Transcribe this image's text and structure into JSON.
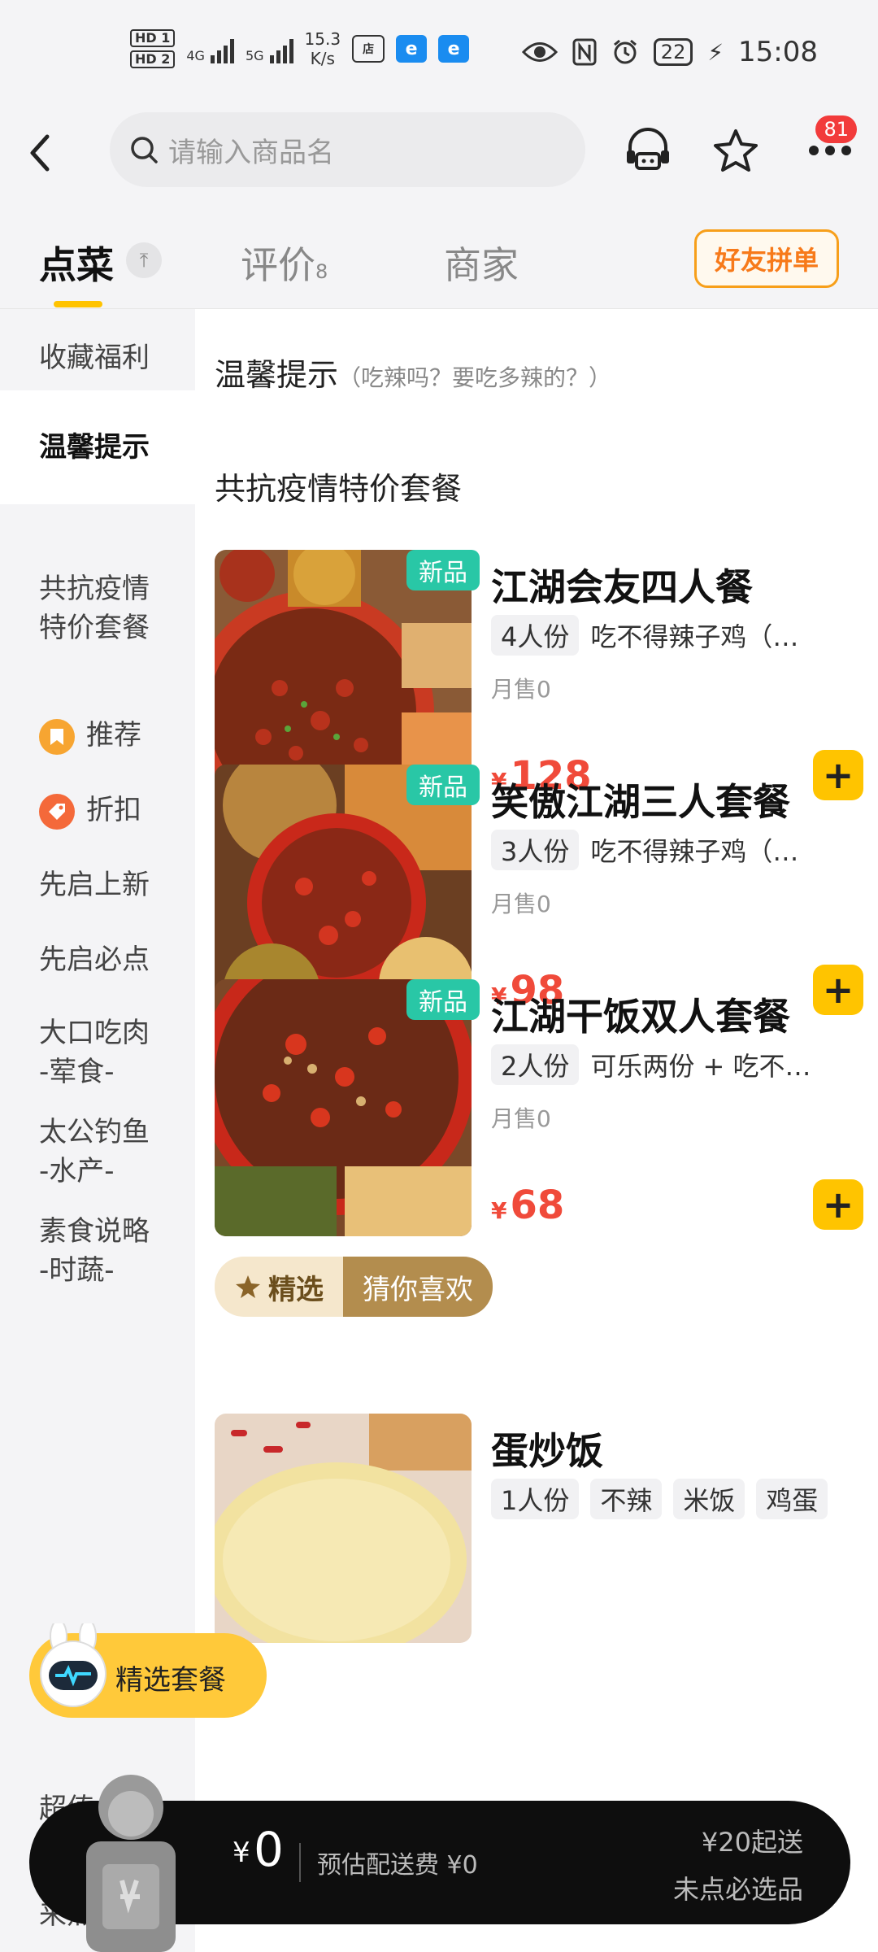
{
  "status_bar": {
    "hd1": "HD 1",
    "hd2": "HD 2",
    "net_4g": "4G",
    "net_5g": "5G",
    "speed_value": "15.3",
    "speed_unit": "K/s",
    "battery": "22",
    "time": "15:08"
  },
  "header": {
    "search_placeholder": "请输入商品名",
    "notification_count": "81"
  },
  "tabs": [
    {
      "label": "点菜"
    },
    {
      "label": "评价",
      "count": "8"
    },
    {
      "label": "商家"
    }
  ],
  "friend_order_label": "好友拼单",
  "sidebar": {
    "items": [
      {
        "label": "收藏福利"
      },
      {
        "label": "温馨提示"
      },
      {
        "label": "共抗疫情\n特价套餐"
      },
      {
        "label": "推荐"
      },
      {
        "label": "折扣"
      },
      {
        "label": "先启上新"
      },
      {
        "label": "先启必点"
      },
      {
        "label": "大口吃肉\n-荤食-"
      },
      {
        "label": "太公钓鱼\n-水产-"
      },
      {
        "label": "素食说略\n-时蔬-"
      },
      {
        "label": "超值"
      },
      {
        "label": "来点主食"
      }
    ]
  },
  "content": {
    "tip_title": "温馨提示",
    "tip_sub": "（吃辣吗？要吃多辣的？）",
    "section_title": "共抗疫情特价套餐",
    "new_tag": "新品",
    "items": [
      {
        "name": "江湖会友四人餐",
        "portion": "4人份",
        "desc": "吃不得辣子鸡（…",
        "sales": "月售0",
        "currency": "¥",
        "price": "128"
      },
      {
        "name": "笑傲江湖三人套餐",
        "portion": "3人份",
        "desc": "吃不得辣子鸡（…",
        "sales": "月售0",
        "currency": "¥",
        "price": "98"
      },
      {
        "name": "江湖干饭双人套餐",
        "portion": "2人份",
        "desc": "可乐两份 + 吃不…",
        "sales": "月售0",
        "currency": "¥",
        "price": "68"
      }
    ],
    "picks_label_a": "精选",
    "picks_label_b": "猜你喜欢",
    "egg_rice": {
      "name": "蛋炒饭",
      "tags": [
        "1人份",
        "不辣",
        "米饭",
        "鸡蛋"
      ]
    }
  },
  "float_pill_label": "精选套餐",
  "cart": {
    "currency": "¥",
    "total": "0",
    "delivery_fee": "预估配送费 ¥0",
    "min_order": "¥20起送",
    "must_pick": "未点必选品"
  },
  "colors": {
    "accent_yellow": "#ffc400",
    "price_red": "#f04a3a",
    "new_tag_teal": "#29c7a6",
    "friend_orange": "#f77a1a"
  }
}
